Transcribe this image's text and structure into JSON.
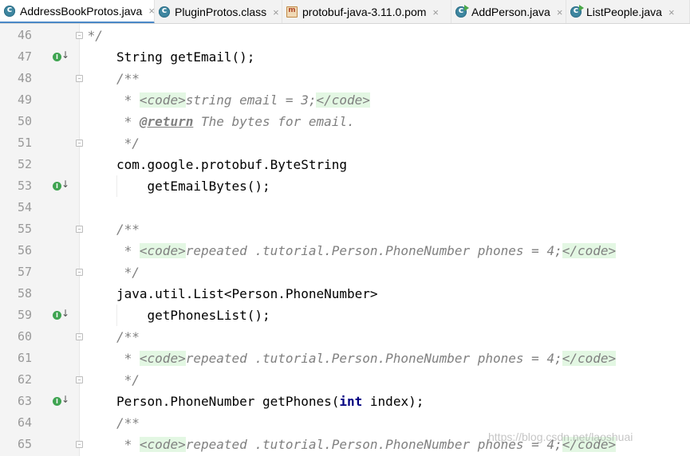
{
  "tabs": [
    {
      "label": "AddressBookProtos.java",
      "icon": "java-class-icon",
      "active": true
    },
    {
      "label": "PluginProtos.class",
      "icon": "java-class-icon",
      "active": false
    },
    {
      "label": "protobuf-java-3.11.0.pom",
      "icon": "maven-pom-icon",
      "active": false
    },
    {
      "label": "AddPerson.java",
      "icon": "java-runnable-class-icon",
      "active": false
    },
    {
      "label": "ListPeople.java",
      "icon": "java-runnable-class-icon",
      "active": false
    }
  ],
  "close_glyph": "×",
  "line_numbers": [
    "46",
    "47",
    "48",
    "49",
    "50",
    "51",
    "52",
    "53",
    "54",
    "55",
    "56",
    "57",
    "58",
    "59",
    "60",
    "61",
    "62",
    "63",
    "64",
    "65"
  ],
  "implemented_marker_glyph": "I",
  "implemented_arrow_glyph": "↓",
  "code": {
    "l46": " */",
    "l47": "String getEmail();",
    "l48": "/**",
    "l49_star": " * ",
    "l49_open": "<code>",
    "l49_text": "string email = 3;",
    "l49_close": "</code>",
    "l50_star": " * ",
    "l50_tag": "@return",
    "l50_text": " The bytes for email.",
    "l51": " */",
    "l52": "com.google.protobuf.ByteString",
    "l53_indent": "    ",
    "l53_name": "getEmailBytes",
    "l53_rest": "();",
    "l55": "/**",
    "l56_star": " * ",
    "l56_open": "<code>",
    "l56_text": "repeated .tutorial.Person.PhoneNumber phones = 4;",
    "l56_close": "</code>",
    "l57": " */",
    "l58": "java.util.List<Person.PhoneNumber>",
    "l59": "    getPhonesList();",
    "l60": "/**",
    "l61_star": " * ",
    "l61_open": "<code>",
    "l61_text": "repeated .tutorial.Person.PhoneNumber phones = 4;",
    "l61_close": "</code>",
    "l62": " */",
    "l63_type": "Person.PhoneNumber ",
    "l63_name": "getPhones",
    "l63_open": "(",
    "l63_kw": "int",
    "l63_rest": " index);",
    "l64": "/**",
    "l65_star": " * ",
    "l65_open": "<code>",
    "l65_text": "repeated .tutorial.Person.PhoneNumber phones = 4;",
    "l65_close": "</code>"
  },
  "watermark": "https://blog.csdn.net/laoshuai",
  "colors": {
    "comment": "#808080",
    "code_tag_background": "#e3f7e3",
    "keyword": "#000080",
    "gutter": "#f4f4f4",
    "implemented_marker": "#3fa451",
    "active_tab_underline": "#4a88c7"
  }
}
